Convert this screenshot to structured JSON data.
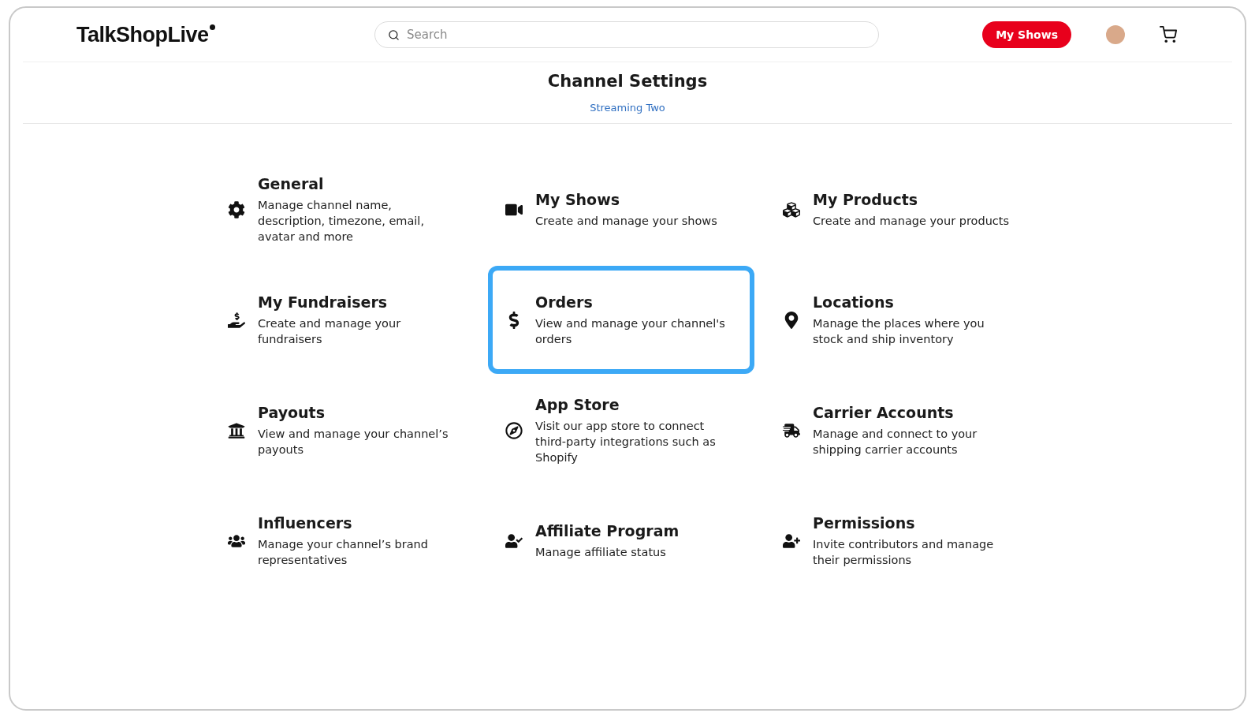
{
  "header": {
    "logo": "TalkShopLive",
    "search": {
      "placeholder": "Search"
    },
    "button": "My Shows"
  },
  "page": {
    "title": "Channel Settings",
    "subtitle": "Streaming Two"
  },
  "settings": [
    {
      "title": "General",
      "description": "Manage channel name, description, timezone, email, avatar and more",
      "selected": false
    },
    {
      "title": "My Shows",
      "description": "Create and manage your shows",
      "selected": false
    },
    {
      "title": "My Products",
      "description": "Create and manage your products",
      "selected": false
    },
    {
      "title": "My Fundraisers",
      "description": "Create and manage your fundraisers",
      "selected": false
    },
    {
      "title": "Orders",
      "description": "View and manage your channel's orders",
      "selected": true
    },
    {
      "title": "Locations",
      "description": "Manage the places where you stock and ship inventory",
      "selected": false
    },
    {
      "title": "Payouts",
      "description": "View and manage your channel’s payouts",
      "selected": false
    },
    {
      "title": "App Store",
      "description": "Visit our app store to connect third-party integrations such as Shopify",
      "selected": false
    },
    {
      "title": "Carrier Accounts",
      "description": "Manage and connect to your shipping carrier accounts",
      "selected": false
    },
    {
      "title": "Influencers",
      "description": "Manage your channel’s brand representatives",
      "selected": false
    },
    {
      "title": "Affiliate Program",
      "description": "Manage affiliate status",
      "selected": false
    },
    {
      "title": "Permissions",
      "description": "Invite contributors and manage their permissions",
      "selected": false
    }
  ]
}
